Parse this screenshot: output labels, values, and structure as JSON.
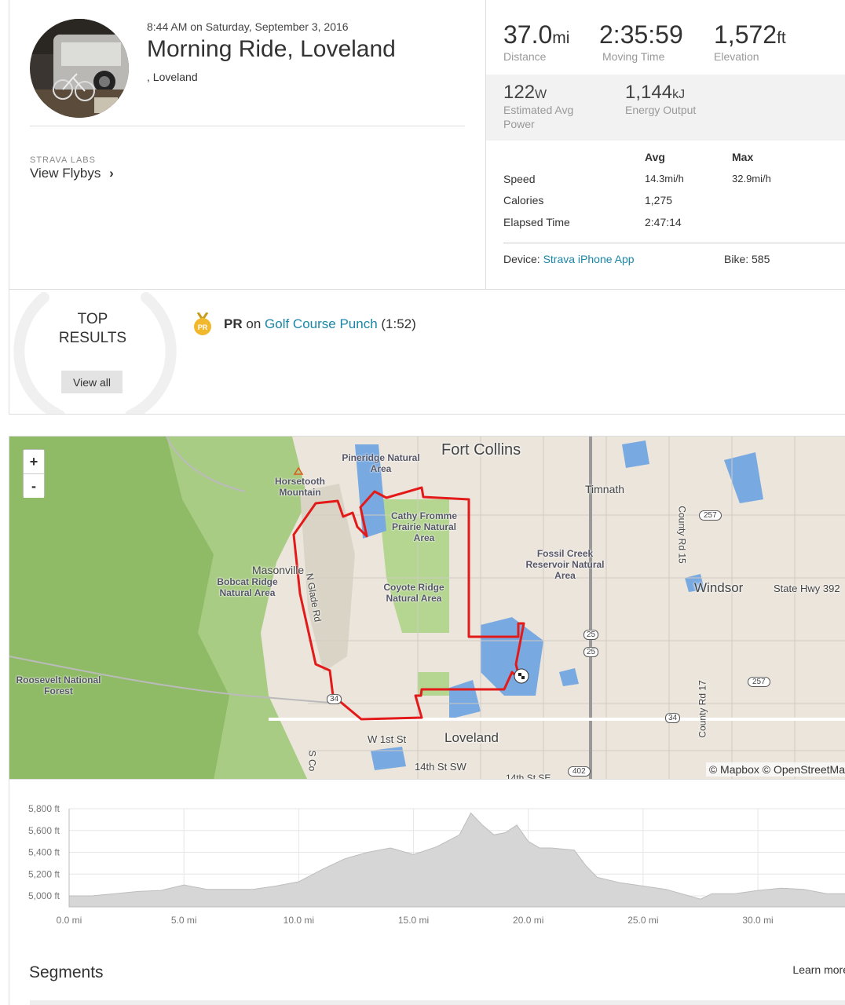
{
  "activity": {
    "datetime": "8:44 AM on Saturday, September 3, 2016",
    "title": "Morning Ride, Loveland",
    "location": ", Loveland"
  },
  "labs": {
    "label": "STRAVA LABS",
    "link": "View Flybys",
    "chevron": "›"
  },
  "stats": {
    "distance": {
      "value": "37.0",
      "unit": "mi",
      "label": "Distance"
    },
    "moving_time": {
      "value": "2:35:59",
      "label": "Moving Time"
    },
    "elevation": {
      "value": "1,572",
      "unit": "ft",
      "label": "Elevation"
    },
    "power": {
      "value": "122",
      "unit": "W",
      "label_line1": "Estimated Avg",
      "label_line2": "Power"
    },
    "energy": {
      "value": "1,144",
      "unit": "kJ",
      "label": "Energy Output"
    }
  },
  "table": {
    "col_avg": "Avg",
    "col_max": "Max",
    "rows": [
      {
        "label": "Speed",
        "avg": "14.3mi/h",
        "max": "32.9mi/h"
      },
      {
        "label": "Calories",
        "avg": "1,275",
        "max": ""
      },
      {
        "label": "Elapsed Time",
        "avg": "2:47:14",
        "max": ""
      }
    ]
  },
  "device": {
    "label": "Device:",
    "value": "Strava iPhone App",
    "bike_label": "Bike:",
    "bike_value": "585"
  },
  "top_results": {
    "title_line1": "TOP",
    "title_line2": "RESULTS",
    "view_all": "View all",
    "pr_badge": "PR",
    "pr_label": "PR",
    "pr_on": "on",
    "pr_segment": "Golf Course Punch",
    "pr_time": "(1:52)"
  },
  "map": {
    "zoom_in": "+",
    "zoom_out": "-",
    "attribution": "© Mapbox © OpenStreetMa",
    "labels": {
      "fort_collins": "Fort Collins",
      "pineridge": "Pineridge Natural Area",
      "horsetooth": "Horsetooth Mountain",
      "timnath": "Timnath",
      "cathy": "Cathy Fromme Prairie Natural Area",
      "masonville": "Masonville",
      "bobcat": "Bobcat Ridge Natural Area",
      "coyote": "Coyote Ridge Natural Area",
      "fossil": "Fossil Creek Reservoir Natural Area",
      "windsor": "Windsor",
      "hwy392": "State Hwy 392",
      "roosevelt": "Roosevelt National Forest",
      "loveland": "Loveland",
      "w1st": "W 1st St",
      "w14th": "14th St SW",
      "e14th": "14th St SE",
      "county15": "County Rd 15",
      "county17": "County Rd 17",
      "nglade": "N Glade Rd",
      "scou": "S Co",
      "s257a": "257",
      "s257b": "257",
      "i25a": "25",
      "i25b": "25",
      "us34a": "34",
      "us34b": "34",
      "s402": "402"
    }
  },
  "elevation_chart": {
    "y_ticks": [
      "5,800 ft",
      "5,600 ft",
      "5,400 ft",
      "5,200 ft",
      "5,000 ft"
    ],
    "x_ticks": [
      "0.0 mi",
      "5.0 mi",
      "10.0 mi",
      "15.0 mi",
      "20.0 mi",
      "25.0 mi",
      "30.0 mi"
    ]
  },
  "chart_data": {
    "type": "area",
    "title": "",
    "xlabel": "",
    "ylabel": "",
    "xlim": [
      0,
      34
    ],
    "ylim": [
      4900,
      5800
    ],
    "grid": true,
    "series": [
      {
        "x": [
          0,
          1,
          2,
          3,
          4,
          5,
          6,
          7,
          8,
          9,
          10,
          11,
          12,
          13,
          14,
          15,
          16,
          17,
          17.5,
          18,
          18.5,
          19,
          19.5,
          20,
          20.5,
          21,
          22,
          22.5,
          23,
          24,
          25,
          26,
          27,
          27.5,
          28,
          29,
          30,
          31,
          32,
          33,
          34
        ],
        "y": [
          5000,
          5000,
          5020,
          5040,
          5050,
          5100,
          5060,
          5060,
          5060,
          5090,
          5130,
          5240,
          5340,
          5400,
          5440,
          5380,
          5450,
          5560,
          5760,
          5650,
          5560,
          5580,
          5650,
          5500,
          5440,
          5440,
          5420,
          5280,
          5170,
          5120,
          5090,
          5060,
          5000,
          4970,
          5020,
          5020,
          5050,
          5070,
          5060,
          5020,
          5020
        ]
      }
    ]
  },
  "segments": {
    "title": "Segments",
    "learn_more": "Learn more"
  }
}
